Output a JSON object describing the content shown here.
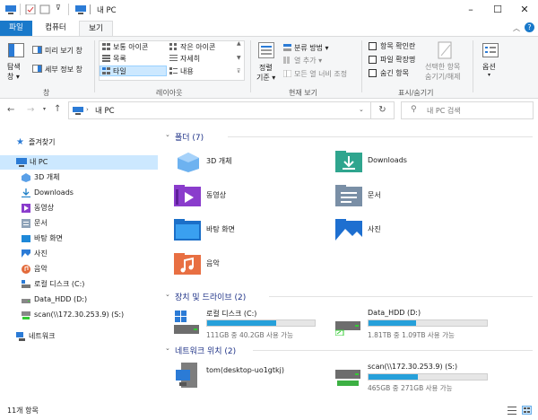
{
  "title": "내 PC",
  "tabs": {
    "file": "파일",
    "computer": "컴퓨터",
    "view": "보기"
  },
  "ribbon": {
    "pane": {
      "nav_pane": "탐색\n창",
      "nav_pane_l1": "탐색",
      "nav_pane_l2": "창 ▾",
      "preview": "미리 보기 창",
      "details": "세부 정보 창",
      "group": "창"
    },
    "layout": {
      "items": [
        "보통 아이콘",
        "작은 아이콘",
        "목록",
        "자세히",
        "타일",
        "내용"
      ],
      "group": "레이아웃"
    },
    "current_view": {
      "sort_l1": "정렬",
      "sort_l2": "기준 ▾",
      "group_by": "분류 방법 ▾",
      "add_column": "열 추가 ▾",
      "fit_columns": "모든 열 너비 조정",
      "group": "현재 보기"
    },
    "show_hide": {
      "item_checkboxes": "항목 확인란",
      "file_extensions": "파일 확장명",
      "hidden_items": "숨긴 항목",
      "hide_selected_l1": "선택한 항목",
      "hide_selected_l2": "숨기기/해제",
      "group": "표시/숨기기"
    },
    "options": {
      "label": "옵션",
      "arrow": "▾"
    }
  },
  "address": {
    "path": "내 PC",
    "search_placeholder": "내 PC 검색"
  },
  "nav": {
    "quick_access": "즐겨찾기",
    "this_pc": "내 PC",
    "children": [
      "3D 개체",
      "Downloads",
      "동영상",
      "문서",
      "바탕 화면",
      "사진",
      "음악",
      "로컬 디스크 (C:)",
      "Data_HDD (D:)",
      "scan(\\\\172.30.253.9) (S:)"
    ],
    "network": "네트워크"
  },
  "folders": {
    "header": "폴더 (7)",
    "items": [
      "3D 개체",
      "Downloads",
      "동영상",
      "문서",
      "바탕 화면",
      "사진",
      "음악"
    ]
  },
  "drives": {
    "header": "장치 및 드라이브 (2)",
    "items": [
      {
        "name": "로컬 디스크 (C:)",
        "info": "111GB 중 40.2GB 사용 가능",
        "used_fraction": 0.64
      },
      {
        "name": "Data_HDD (D:)",
        "info": "1.81TB 중 1.09TB 사용 가능",
        "used_fraction": 0.4
      }
    ]
  },
  "network": {
    "header": "네트워크 위치 (2)",
    "items": [
      {
        "name": "tom(desktop-uo1gtkj)"
      },
      {
        "name": "scan(\\\\172.30.253.9) (S:)",
        "info": "465GB 중 271GB 사용 가능",
        "used_fraction": 0.42
      }
    ]
  },
  "status": {
    "count": "11개 항목"
  },
  "colors": {
    "accent": "#1979ca",
    "selected": "#cce8ff",
    "drive_bar": "#26a0da",
    "header": "#1e3287"
  }
}
